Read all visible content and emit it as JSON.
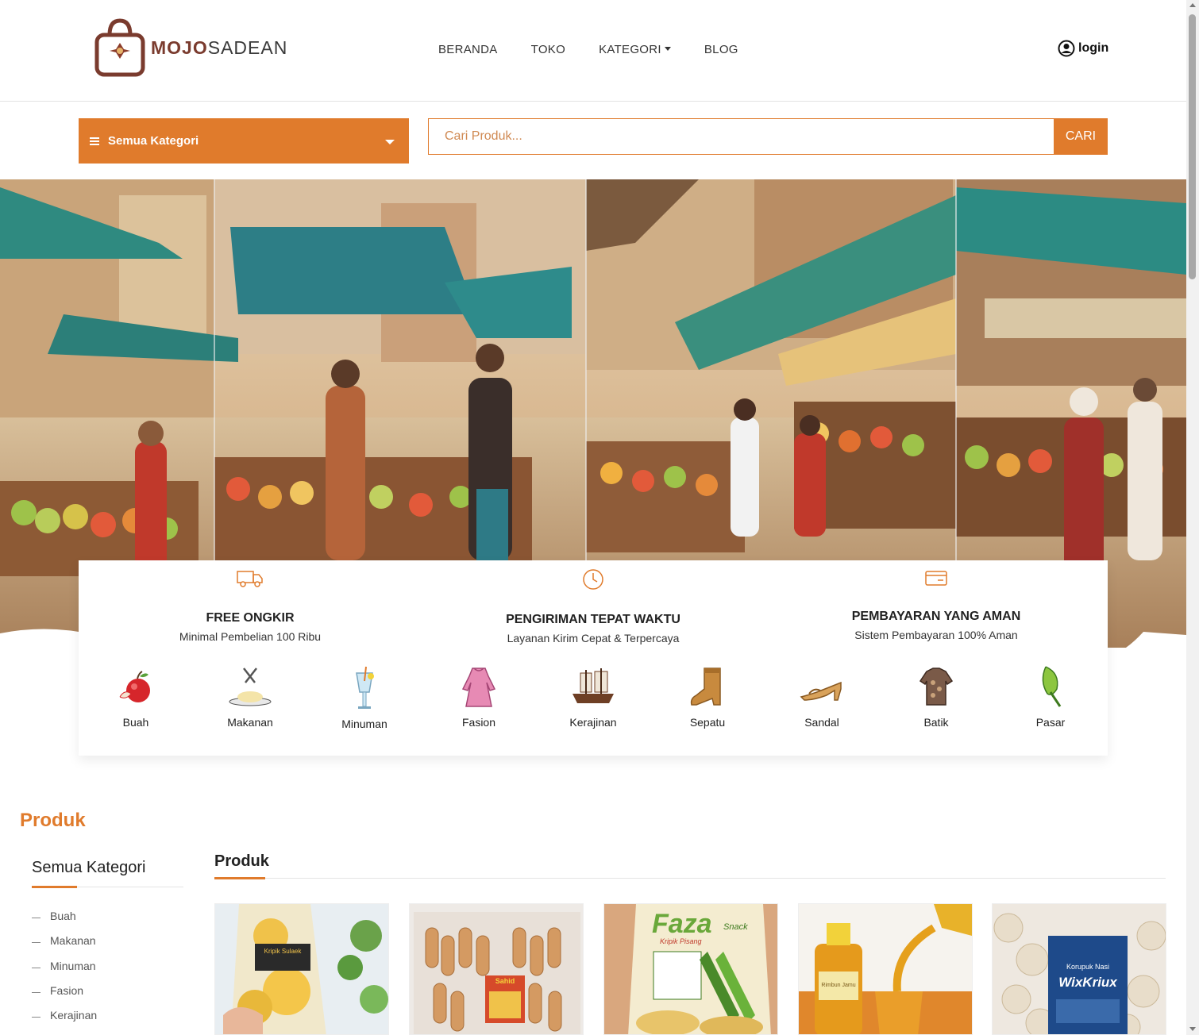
{
  "brand": {
    "name_part1": "MOJO",
    "name_part2": "SADEAN",
    "color": "#7a3b2e"
  },
  "nav": {
    "items": [
      "BERANDA",
      "TOKO",
      "KATEGORI",
      "BLOG"
    ],
    "login_label": "login"
  },
  "search": {
    "category_label": "Semua Kategori",
    "placeholder": "Cari Produk...",
    "button_label": "CARI"
  },
  "theme": {
    "accent": "#e07b2c"
  },
  "features": [
    {
      "icon": "truck-icon",
      "title": "FREE ONGKIR",
      "subtitle": "Minimal Pembelian 100 Ribu"
    },
    {
      "icon": "clock-icon",
      "title": "PENGIRIMAN TEPAT WAKTU",
      "subtitle": "Layanan Kirim Cepat & Terpercaya"
    },
    {
      "icon": "credit-card-icon",
      "title": "PEMBAYARAN YANG AMAN",
      "subtitle": "Sistem Pembayaran 100% Aman"
    }
  ],
  "categories": [
    {
      "label": "Buah",
      "icon": "apple-icon"
    },
    {
      "label": "Makanan",
      "icon": "food-plate-icon"
    },
    {
      "label": "Minuman",
      "icon": "drink-glass-icon"
    },
    {
      "label": "Fasion",
      "icon": "dress-icon"
    },
    {
      "label": "Kerajinan",
      "icon": "ship-craft-icon"
    },
    {
      "label": "Sepatu",
      "icon": "boot-icon"
    },
    {
      "label": "Sandal",
      "icon": "sandal-icon"
    },
    {
      "label": "Batik",
      "icon": "batik-shirt-icon"
    },
    {
      "label": "Pasar",
      "icon": "vegetable-icon"
    }
  ],
  "products_section": {
    "title": "Produk",
    "sidebar_heading": "Semua Kategori",
    "sidebar_items": [
      "Buah",
      "Makanan",
      "Minuman",
      "Fasion",
      "Kerajinan"
    ],
    "main_heading": "Produk",
    "product_images": [
      "keripik-pisang-bag",
      "sahid-snack-bag",
      "faza-snack-bag",
      "honey-bottle-glass",
      "wixkriux-kerupuk-bag"
    ],
    "product_labels": {
      "p1_brand": "Kripik Sulaek",
      "p2_brand": "Sahid",
      "p3_brand": "Faza",
      "p3_sub": "Snack",
      "p3_line": "Kripik Pisang",
      "p4_brand": "Rimbun Jamu",
      "p5_brand": "WixKriux",
      "p5_line": "Korupuk Nasi"
    }
  }
}
